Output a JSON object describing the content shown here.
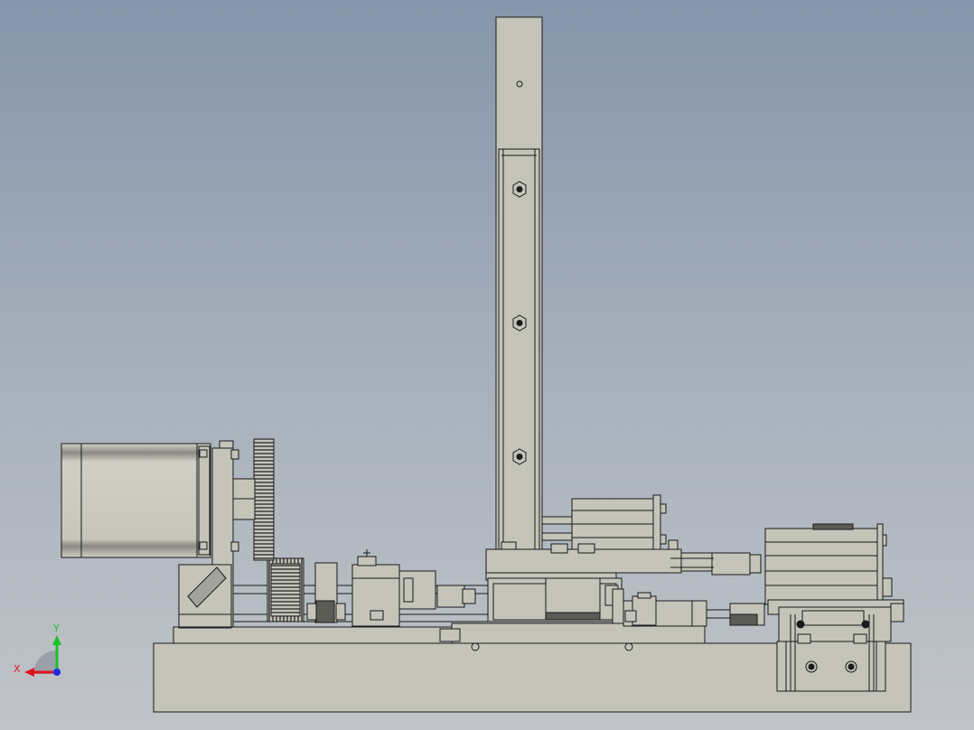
{
  "viewport": {
    "background_top": "#8695aa",
    "background_bottom": "#c0c4c8",
    "part_fill": "#c4c4b9",
    "part_shade": "#a3a39a",
    "edge_color": "#1a1a1a"
  },
  "triad": {
    "x_label": "X",
    "y_label": "Y",
    "x_color": "#e0141e",
    "y_color": "#19c226",
    "z_color": "#1e28e6"
  }
}
